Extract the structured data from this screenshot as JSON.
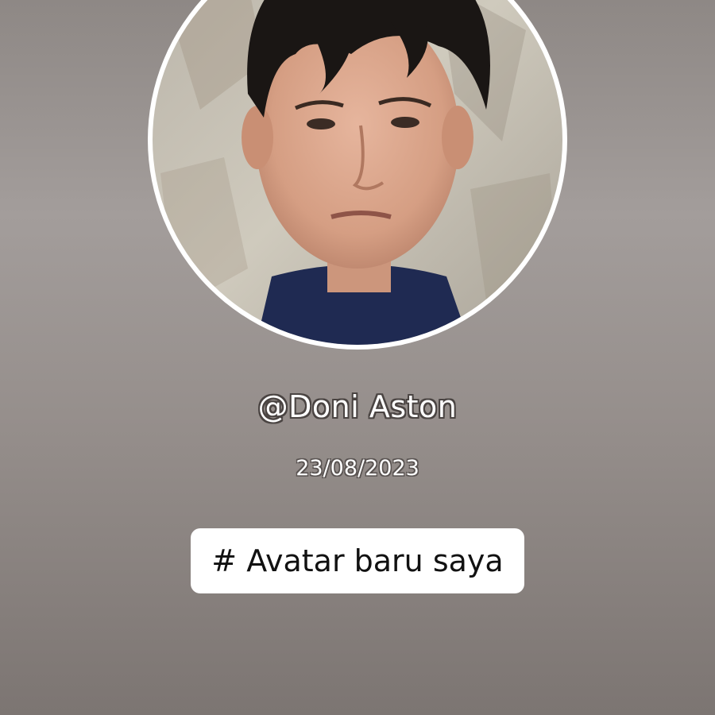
{
  "profile": {
    "username": "@Doni Aston",
    "date": "23/08/2023",
    "avatar_icon": "profile-photo",
    "tag": "# Avatar baru saya"
  },
  "colors": {
    "background_top": "#8e8885",
    "background_bottom": "#7c7572",
    "frame": "#ffffff",
    "tag_box": "#ffffff",
    "tag_text": "#111111"
  }
}
